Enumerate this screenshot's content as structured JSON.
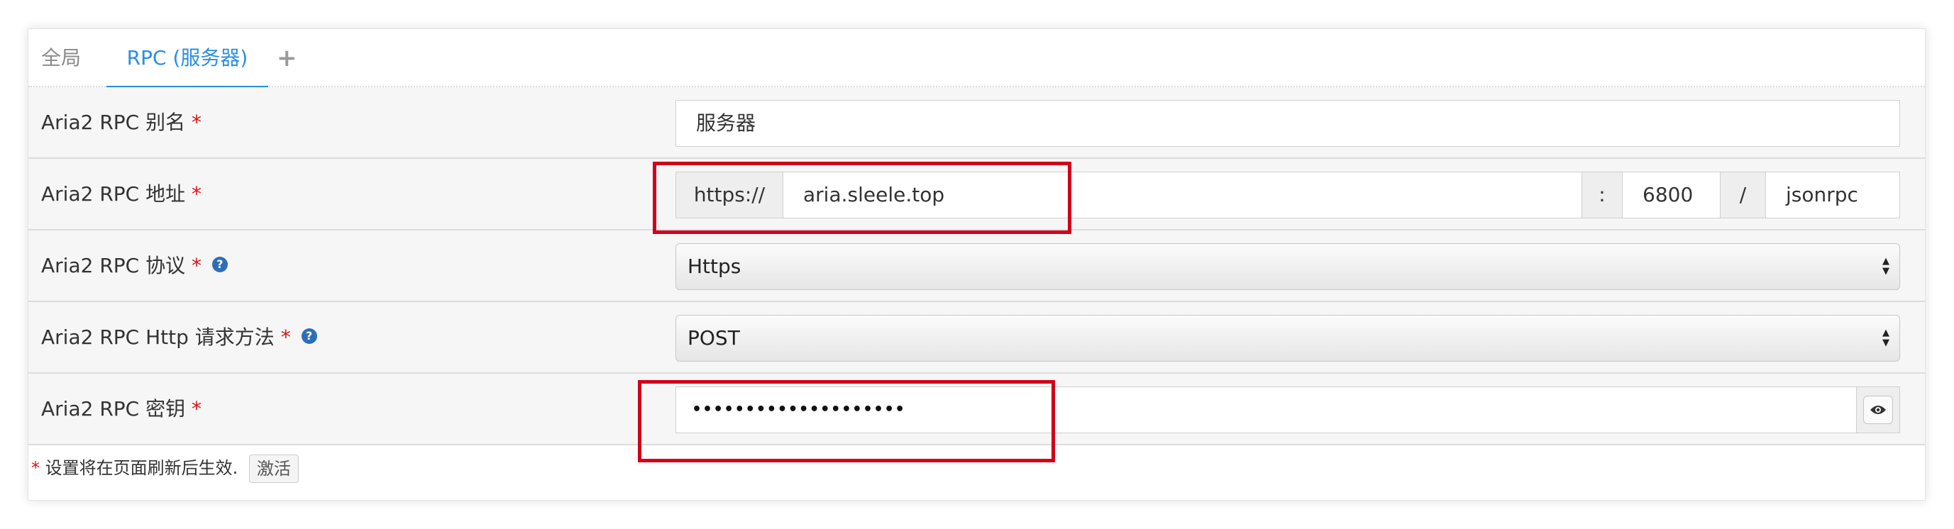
{
  "tabs": {
    "global": "全局",
    "rpc": "RPC (服务器)",
    "add": "+"
  },
  "rows": {
    "alias": {
      "label": "Aria2 RPC 别名",
      "required": "*",
      "value": "服务器"
    },
    "address": {
      "label": "Aria2 RPC 地址",
      "required": "*",
      "protocol_prefix": "https://",
      "host": "aria.sleele.top",
      "colon": ":",
      "port": "6800",
      "slash": "/",
      "path": "jsonrpc"
    },
    "protocol": {
      "label": "Aria2 RPC 协议",
      "required": "*",
      "help": "?",
      "selected": "Https"
    },
    "http_method": {
      "label": "Aria2 RPC Http 请求方法",
      "required": "*",
      "help": "?",
      "selected": "POST"
    },
    "secret": {
      "label": "Aria2 RPC 密钥",
      "required": "*",
      "masked_value": "••••••••••••••••••••"
    }
  },
  "footer": {
    "required": "*",
    "note": "设置将在页面刷新后生效.",
    "activate_label": "激活"
  },
  "colors": {
    "accent": "#2a8fe0",
    "required": "#d9141a",
    "highlight": "#d0021b"
  }
}
